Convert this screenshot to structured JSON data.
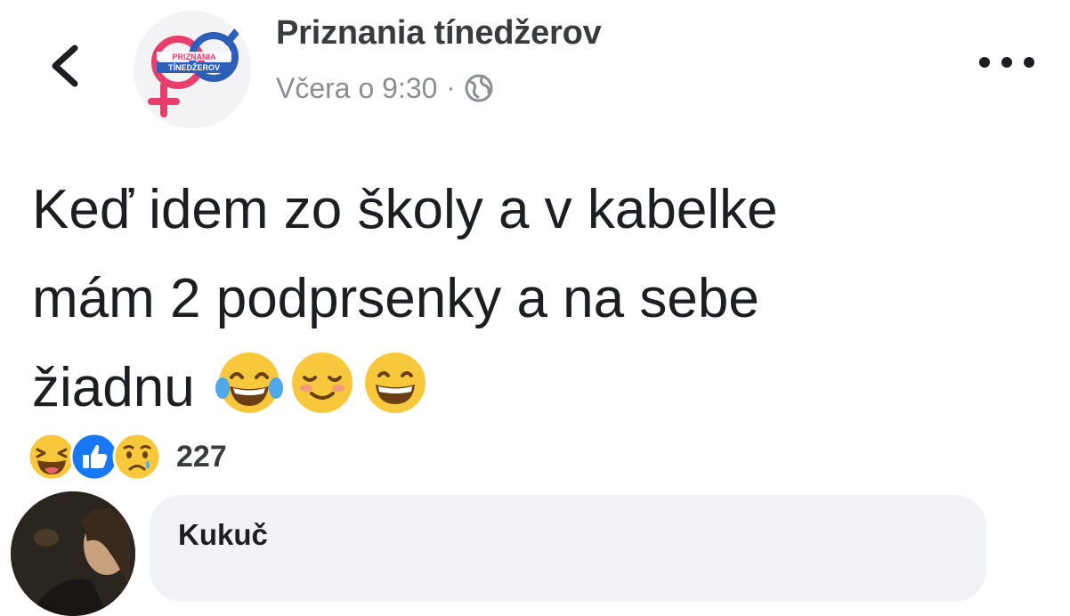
{
  "header": {
    "page_name": "Priznania tínedžerov",
    "timestamp": "Včera o 9:30",
    "separator": "·",
    "privacy_icon": "globe-icon",
    "back_icon": "chevron-left-icon",
    "more_icon": "more-horizontal-icon",
    "logo_lines": [
      "PRIZNANIA",
      "TÍNEDŽEROV"
    ]
  },
  "post": {
    "lines": [
      "Keď idem zo školy a v kabelke",
      "mám 2 podprsenky a na sebe",
      "žiadnu"
    ],
    "emojis": [
      "tears-of-joy-emoji",
      "smiling-blush-emoji",
      "grinning-emoji"
    ]
  },
  "reactions": {
    "icons": [
      "haha-reaction-icon",
      "like-reaction-icon",
      "sad-reaction-icon"
    ],
    "count": "227"
  },
  "comment": {
    "author": "Kukuč"
  },
  "colors": {
    "like_blue": "#1877f2",
    "emoji_yellow": "#f7c83c",
    "comment_bg": "#f0f2f5",
    "meta_gray": "#8a8d91",
    "logo_pink": "#e83e6c",
    "logo_blue": "#2e5fb8"
  }
}
